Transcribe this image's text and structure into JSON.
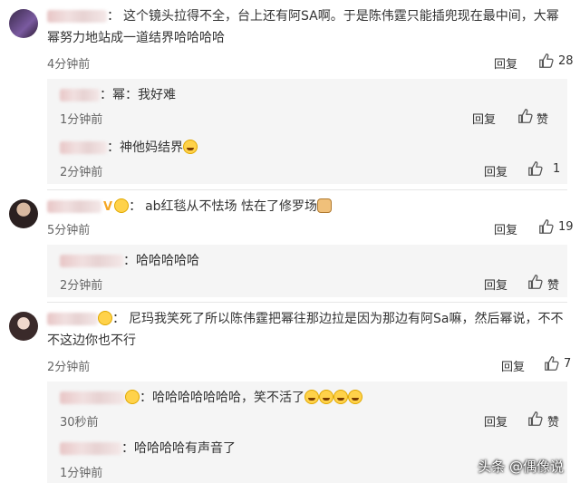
{
  "comments": [
    {
      "text": "这个镜头拉得不全，台上还有阿SA啊。于是陈伟霆只能插兜现在最中间，大幂幂努力地站成一道结界哈哈哈哈",
      "time": "4分钟前",
      "reply": "回复",
      "likes": "28",
      "subs": [
        {
          "text": "幂：我好难",
          "time": "1分钟前",
          "reply": "回复",
          "likes": "赞"
        },
        {
          "text": "神他妈结界",
          "time": "2分钟前",
          "reply": "回复",
          "likes": "1"
        }
      ]
    },
    {
      "text": "ab红毯从不怯场 怯在了修罗场",
      "time": "5分钟前",
      "reply": "回复",
      "likes": "19",
      "subs": [
        {
          "text": "哈哈哈哈哈",
          "time": "2分钟前",
          "reply": "回复",
          "likes": "赞"
        }
      ]
    },
    {
      "text": "尼玛我笑死了所以陈伟霆把幂往那边拉是因为那边有阿Sa嘛，然后幂说，不不不这边你也不行",
      "time": "2分钟前",
      "reply": "回复",
      "likes": "7",
      "subs": [
        {
          "text": "哈哈哈哈哈哈哈，笑不活了",
          "time": "30秒前",
          "reply": "回复",
          "likes": "赞"
        },
        {
          "text": "哈哈哈哈有声音了",
          "time": "1分钟前",
          "reply": "回复",
          "likes": "赞"
        }
      ]
    }
  ],
  "watermark": "头条 @偶像说"
}
